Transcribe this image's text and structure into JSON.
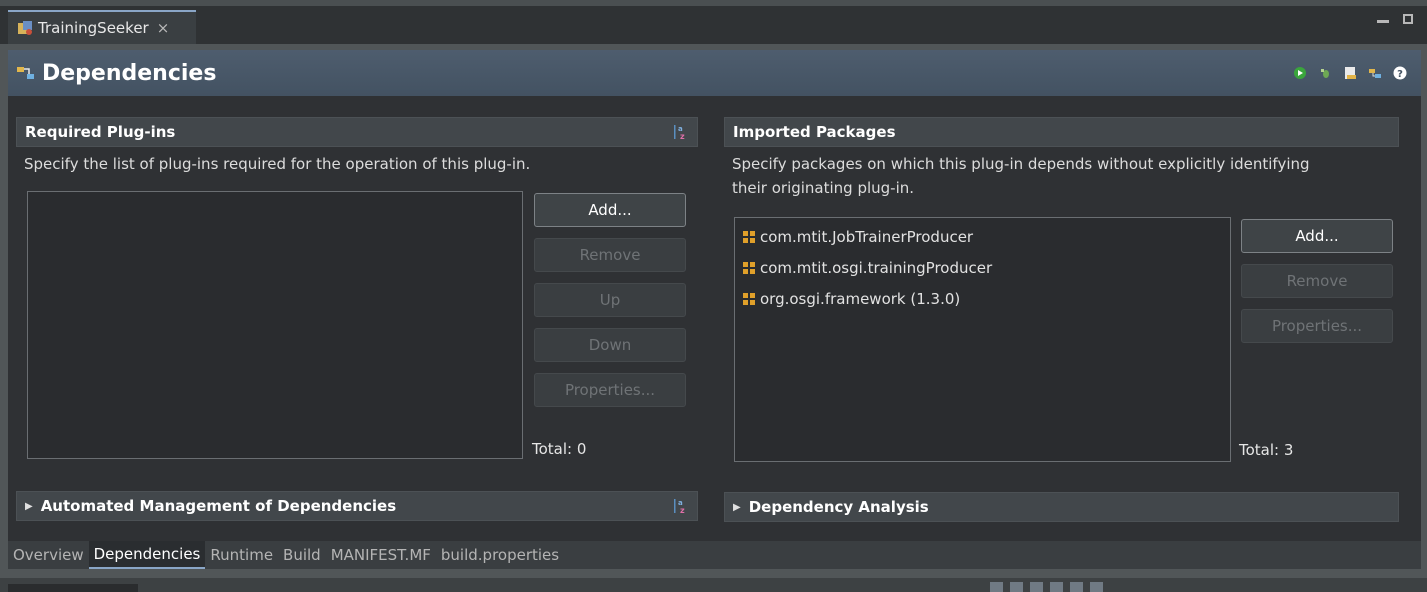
{
  "editor_tab": {
    "title": "TrainingSeeker",
    "close_glyph": "×"
  },
  "form": {
    "title": "Dependencies",
    "toolbar_icons": [
      "run-icon",
      "debug-icon",
      "export-icon",
      "manifest-icon",
      "help-icon"
    ]
  },
  "required_plugins": {
    "title": "Required Plug-ins",
    "description": "Specify the list of plug-ins required for the operation of this plug-in.",
    "buttons": {
      "add": "Add...",
      "remove": "Remove",
      "up": "Up",
      "down": "Down",
      "properties": "Properties..."
    },
    "items": [],
    "total": "Total: 0"
  },
  "imported_packages": {
    "title": "Imported Packages",
    "description_line1": "Specify packages on which this plug-in depends without explicitly identifying",
    "description_line2": "their originating plug-in.",
    "buttons": {
      "add": "Add...",
      "remove": "Remove",
      "properties": "Properties..."
    },
    "items": [
      "com.mtit.JobTrainerProducer",
      "com.mtit.osgi.trainingProducer",
      "org.osgi.framework (1.3.0)"
    ],
    "total": "Total: 3"
  },
  "automated_management": {
    "title": "Automated Management of Dependencies"
  },
  "dependency_analysis": {
    "title": "Dependency Analysis"
  },
  "page_tabs": [
    "Overview",
    "Dependencies",
    "Runtime",
    "Build",
    "MANIFEST.MF",
    "build.properties"
  ],
  "active_page_tab": "Dependencies",
  "colors": {
    "header_bg": "#4e5d6e",
    "content_bg": "#2f3134",
    "section_bg": "#42474b",
    "package_icon": "#e0a02a",
    "active_tab_accent": "#8aa6c7"
  }
}
